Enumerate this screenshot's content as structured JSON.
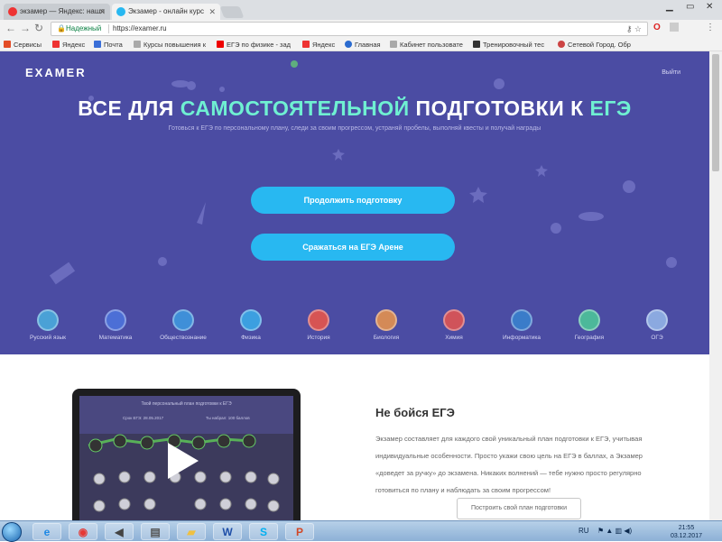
{
  "browser": {
    "tabs": [
      {
        "title": "экзамер — Яндекс: нашл",
        "favicon": "yandex-icon",
        "color": "#e33"
      },
      {
        "title": "Экзамер - онлайн курс",
        "favicon": "examer-icon",
        "color": "#28b8f1"
      }
    ],
    "address": {
      "secure_label": "Надежный",
      "url": "https://examer.ru"
    },
    "bookmarks": [
      {
        "label": "Сервисы",
        "icon": "apps-icon",
        "color": "#e34c26"
      },
      {
        "label": "Яндекс",
        "icon": "yandex-icon",
        "color": "#e33"
      },
      {
        "label": "Почта",
        "icon": "mail-icon",
        "color": "#3a6fd8"
      },
      {
        "label": "Курсы повышения к",
        "icon": "page-icon",
        "color": "#aaa"
      },
      {
        "label": "ЕГЭ по физике - зад",
        "icon": "youtube-icon",
        "color": "#e00"
      },
      {
        "label": "Яндекс",
        "icon": "yandex-icon",
        "color": "#e33"
      },
      {
        "label": "Главная",
        "icon": "globe-icon",
        "color": "#2a6bcf"
      },
      {
        "label": "Кабинет пользовате",
        "icon": "page-icon",
        "color": "#aaa"
      },
      {
        "label": "Тренировочный тес",
        "icon": "edu-icon",
        "color": "#333"
      },
      {
        "label": "Сетевой Город. Обр",
        "icon": "city-icon",
        "color": "#c44"
      }
    ]
  },
  "site": {
    "logo": "EXAMER",
    "logout": "Выйти",
    "headline": {
      "part1": "ВСЕ ДЛЯ",
      "accent1": "САМОСТОЯТЕЛЬНОЙ",
      "part2": "ПОДГОТОВКИ К",
      "accent2": "ЕГЭ"
    },
    "subline": "Готовься к ЕГЭ по персональному плану, следи за своим прогрессом, устраняй пробелы, выполняй квесты и получай награды",
    "buttons": {
      "continue": "Продолжить подготовку",
      "arena": "Сражаться на ЕГЭ Арене"
    },
    "subjects": [
      {
        "label": "Русский язык",
        "color": "#4aa1d6"
      },
      {
        "label": "Математика",
        "color": "#4c6fd6"
      },
      {
        "label": "Обществознание",
        "color": "#3f8fd8"
      },
      {
        "label": "Физика",
        "color": "#3c9fe0"
      },
      {
        "label": "История",
        "color": "#d65454"
      },
      {
        "label": "Биология",
        "color": "#d48a57"
      },
      {
        "label": "Химия",
        "color": "#d0535a"
      },
      {
        "label": "Информатика",
        "color": "#3a7cc9"
      },
      {
        "label": "География",
        "color": "#4cb89a"
      },
      {
        "label": "ОГЭ",
        "color": "#8ba9e0"
      }
    ],
    "video": {
      "caption": "Твой персональный план подготовки к ЕГЭ",
      "stat1": "Срок ЕГЭ: 28.05.2017",
      "stat2": "Ты набрал: 100 баллов"
    },
    "about": {
      "title": "Не бойся ЕГЭ",
      "text": "Экзамер составляет для каждого свой уникальный план подготовки к ЕГЭ, учитывая индивидуальные особенности. Просто укажи свою цель на ЕГЭ в баллах, а Экзамер «доведет за ручку» до экзамена. Никаких волнений — тебе нужно просто регулярно готовиться по плану и наблюдать за своим прогрессом!",
      "button": "Построить свой план подготовки"
    }
  },
  "taskbar": {
    "apps": [
      {
        "name": "ie-icon",
        "glyph": "e",
        "color": "#1e88e5"
      },
      {
        "name": "chrome-icon",
        "glyph": "◉",
        "color": "#e53935"
      },
      {
        "name": "media-icon",
        "glyph": "◀",
        "color": "#444"
      },
      {
        "name": "notepad-icon",
        "glyph": "▤",
        "color": "#555"
      },
      {
        "name": "folder-icon",
        "glyph": "▰",
        "color": "#f0c040"
      },
      {
        "name": "word-icon",
        "glyph": "W",
        "color": "#1f4fa8"
      },
      {
        "name": "skype-icon",
        "glyph": "S",
        "color": "#00aff0"
      },
      {
        "name": "powerpoint-icon",
        "glyph": "P",
        "color": "#d24726"
      }
    ],
    "lang": "RU",
    "time": "21:55",
    "date": "03.12.2017"
  }
}
